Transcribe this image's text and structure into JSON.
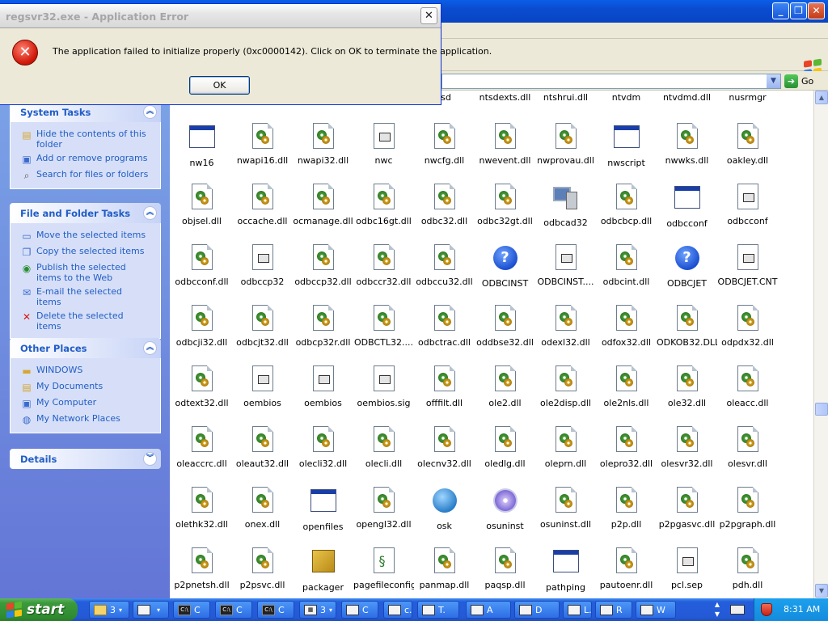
{
  "dialog": {
    "title": "regsvr32.exe - Application Error",
    "close_glyph": "✕",
    "message": "The application failed to initialize properly (0xc0000142). Click on OK to terminate the application.",
    "ok_label": "OK",
    "icon": "error-icon"
  },
  "window": {
    "minimize_glyph": "_",
    "maximize_glyph": "❐",
    "close_glyph": "✕",
    "go_label": "Go",
    "go_glyph": "➔",
    "dropdown_glyph": "▼"
  },
  "panels": [
    {
      "title": "System Tasks",
      "toggle": "︽",
      "items": [
        {
          "label": "Hide the contents of this folder",
          "icon": "folder-hide-icon"
        },
        {
          "label": "Add or remove programs",
          "icon": "add-remove-programs-icon"
        },
        {
          "label": "Search for files or folders",
          "icon": "search-icon"
        }
      ]
    },
    {
      "title": "File and Folder Tasks",
      "toggle": "︽",
      "items": [
        {
          "label": "Move the selected items",
          "icon": "move-icon"
        },
        {
          "label": "Copy the selected items",
          "icon": "copy-icon"
        },
        {
          "label": "Publish the selected items to the Web",
          "icon": "publish-web-icon"
        },
        {
          "label": "E-mail the selected items",
          "icon": "email-icon"
        },
        {
          "label": "Delete the selected items",
          "icon": "delete-icon"
        }
      ]
    },
    {
      "title": "Other Places",
      "toggle": "︽",
      "items": [
        {
          "label": "WINDOWS",
          "icon": "folder-icon"
        },
        {
          "label": "My Documents",
          "icon": "my-documents-icon"
        },
        {
          "label": "My Computer",
          "icon": "my-computer-icon"
        },
        {
          "label": "My Network Places",
          "icon": "network-places-icon"
        }
      ]
    },
    {
      "title": "Details",
      "toggle": "︾",
      "items": []
    }
  ],
  "top_row_labels": [
    "tsd",
    "ntsdexts.dll",
    "ntshrui.dll",
    "ntvdm",
    "ntvdmd.dll",
    "nusrmgr"
  ],
  "files": [
    [
      {
        "name": "nw16",
        "icon": "window"
      },
      {
        "name": "nwapi16.dll",
        "icon": "dll"
      },
      {
        "name": "nwapi32.dll",
        "icon": "dll"
      },
      {
        "name": "nwc",
        "icon": "doc"
      },
      {
        "name": "nwcfg.dll",
        "icon": "dll"
      },
      {
        "name": "nwevent.dll",
        "icon": "dll"
      },
      {
        "name": "nwprovau.dll",
        "icon": "dll"
      },
      {
        "name": "nwscript",
        "icon": "window"
      },
      {
        "name": "nwwks.dll",
        "icon": "dll"
      },
      {
        "name": "oakley.dll",
        "icon": "dll"
      }
    ],
    [
      {
        "name": "objsel.dll",
        "icon": "dll"
      },
      {
        "name": "occache.dll",
        "icon": "dll"
      },
      {
        "name": "ocmanage.dll",
        "icon": "dll"
      },
      {
        "name": "odbc16gt.dll",
        "icon": "dll"
      },
      {
        "name": "odbc32.dll",
        "icon": "dll"
      },
      {
        "name": "odbc32gt.dll",
        "icon": "dll"
      },
      {
        "name": "odbcad32",
        "icon": "pc"
      },
      {
        "name": "odbcbcp.dll",
        "icon": "dll"
      },
      {
        "name": "odbcconf",
        "icon": "window"
      },
      {
        "name": "odbcconf",
        "icon": "doc"
      }
    ],
    [
      {
        "name": "odbcconf.dll",
        "icon": "dll"
      },
      {
        "name": "odbccp32",
        "icon": "doc"
      },
      {
        "name": "odbccp32.dll",
        "icon": "dll"
      },
      {
        "name": "odbccr32.dll",
        "icon": "dll"
      },
      {
        "name": "odbccu32.dll",
        "icon": "dll"
      },
      {
        "name": "ODBCINST",
        "icon": "help"
      },
      {
        "name": "ODBCINST....",
        "icon": "doc"
      },
      {
        "name": "odbcint.dll",
        "icon": "dll"
      },
      {
        "name": "ODBCJET",
        "icon": "help"
      },
      {
        "name": "ODBCJET.CNT",
        "icon": "doc"
      }
    ],
    [
      {
        "name": "odbcji32.dll",
        "icon": "dll"
      },
      {
        "name": "odbcjt32.dll",
        "icon": "dll"
      },
      {
        "name": "odbcp32r.dll",
        "icon": "dll"
      },
      {
        "name": "ODBCTL32....",
        "icon": "dll"
      },
      {
        "name": "odbctrac.dll",
        "icon": "dll"
      },
      {
        "name": "oddbse32.dll",
        "icon": "dll"
      },
      {
        "name": "odexl32.dll",
        "icon": "dll"
      },
      {
        "name": "odfox32.dll",
        "icon": "dll"
      },
      {
        "name": "ODKOB32.DLL",
        "icon": "dll"
      },
      {
        "name": "odpdx32.dll",
        "icon": "dll"
      }
    ],
    [
      {
        "name": "odtext32.dll",
        "icon": "dll"
      },
      {
        "name": "oembios",
        "icon": "doc"
      },
      {
        "name": "oembios",
        "icon": "doc"
      },
      {
        "name": "oembios.sig",
        "icon": "doc"
      },
      {
        "name": "offfilt.dll",
        "icon": "dll"
      },
      {
        "name": "ole2.dll",
        "icon": "dll"
      },
      {
        "name": "ole2disp.dll",
        "icon": "dll"
      },
      {
        "name": "ole2nls.dll",
        "icon": "dll"
      },
      {
        "name": "ole32.dll",
        "icon": "dll"
      },
      {
        "name": "oleacc.dll",
        "icon": "dll"
      }
    ],
    [
      {
        "name": "oleaccrc.dll",
        "icon": "dll"
      },
      {
        "name": "oleaut32.dll",
        "icon": "dll"
      },
      {
        "name": "olecli32.dll",
        "icon": "dll"
      },
      {
        "name": "olecli.dll",
        "icon": "dll"
      },
      {
        "name": "olecnv32.dll",
        "icon": "dll"
      },
      {
        "name": "oledlg.dll",
        "icon": "dll"
      },
      {
        "name": "oleprn.dll",
        "icon": "dll"
      },
      {
        "name": "olepro32.dll",
        "icon": "dll"
      },
      {
        "name": "olesvr32.dll",
        "icon": "dll"
      },
      {
        "name": "olesvr.dll",
        "icon": "dll"
      }
    ],
    [
      {
        "name": "olethk32.dll",
        "icon": "dll"
      },
      {
        "name": "onex.dll",
        "icon": "dll"
      },
      {
        "name": "openfiles",
        "icon": "window"
      },
      {
        "name": "opengl32.dll",
        "icon": "dll"
      },
      {
        "name": "osk",
        "icon": "net"
      },
      {
        "name": "osuninst",
        "icon": "cd"
      },
      {
        "name": "osuninst.dll",
        "icon": "dll"
      },
      {
        "name": "p2p.dll",
        "icon": "dll"
      },
      {
        "name": "p2pgasvc.dll",
        "icon": "dll"
      },
      {
        "name": "p2pgraph.dll",
        "icon": "dll"
      }
    ],
    [
      {
        "name": "p2pnetsh.dll",
        "icon": "dll"
      },
      {
        "name": "p2psvc.dll",
        "icon": "dll"
      },
      {
        "name": "packager",
        "icon": "box"
      },
      {
        "name": "pagefileconfig",
        "icon": "script"
      },
      {
        "name": "panmap.dll",
        "icon": "dll"
      },
      {
        "name": "paqsp.dll",
        "icon": "dll"
      },
      {
        "name": "pathping",
        "icon": "window"
      },
      {
        "name": "pautoenr.dll",
        "icon": "dll"
      },
      {
        "name": "pcl.sep",
        "icon": "doc"
      },
      {
        "name": "pdh.dll",
        "icon": "dll"
      }
    ]
  ],
  "scrollbar": {
    "up_glyph": "▲",
    "down_glyph": "▼",
    "position": 0.64
  },
  "taskbar": {
    "start_label": "start",
    "buttons": [
      {
        "label": "3",
        "icon": "folder-icon",
        "arrow": "▾"
      },
      {
        "label": "",
        "icon": "window-icon",
        "arrow": "▾"
      },
      {
        "label": "C",
        "icon": "console-icon",
        "arrow": ""
      },
      {
        "label": "C",
        "icon": "console-icon",
        "arrow": ""
      },
      {
        "label": "C",
        "icon": "console-icon",
        "arrow": ""
      },
      {
        "label": "3",
        "icon": "app-group-icon",
        "arrow": "▾"
      },
      {
        "label": "C",
        "icon": "window-icon",
        "arrow": ""
      },
      {
        "label": "c.",
        "icon": "document-icon",
        "arrow": ""
      },
      {
        "label": "T.",
        "icon": "notepad-icon",
        "arrow": ""
      },
      {
        "label": "A",
        "icon": "app-icon",
        "arrow": ""
      },
      {
        "label": "D",
        "icon": "settings-icon",
        "arrow": ""
      },
      {
        "label": "L.",
        "icon": "window-icon",
        "arrow": ""
      },
      {
        "label": "R",
        "icon": "regedit-icon",
        "arrow": ""
      },
      {
        "label": "W",
        "icon": "shield-icon",
        "arrow": ""
      }
    ],
    "tray_up": "▲",
    "tray_down": "▼",
    "clock": "8:31 AM"
  },
  "colors": {
    "title_bar": "#0a4bd0",
    "left_pane_top": "#7ba2e7",
    "left_pane_bottom": "#6375d6",
    "link_text": "#215dc6",
    "taskbar": "#245edc",
    "start_green": "#3c9a3c",
    "tray": "#148bdc"
  }
}
